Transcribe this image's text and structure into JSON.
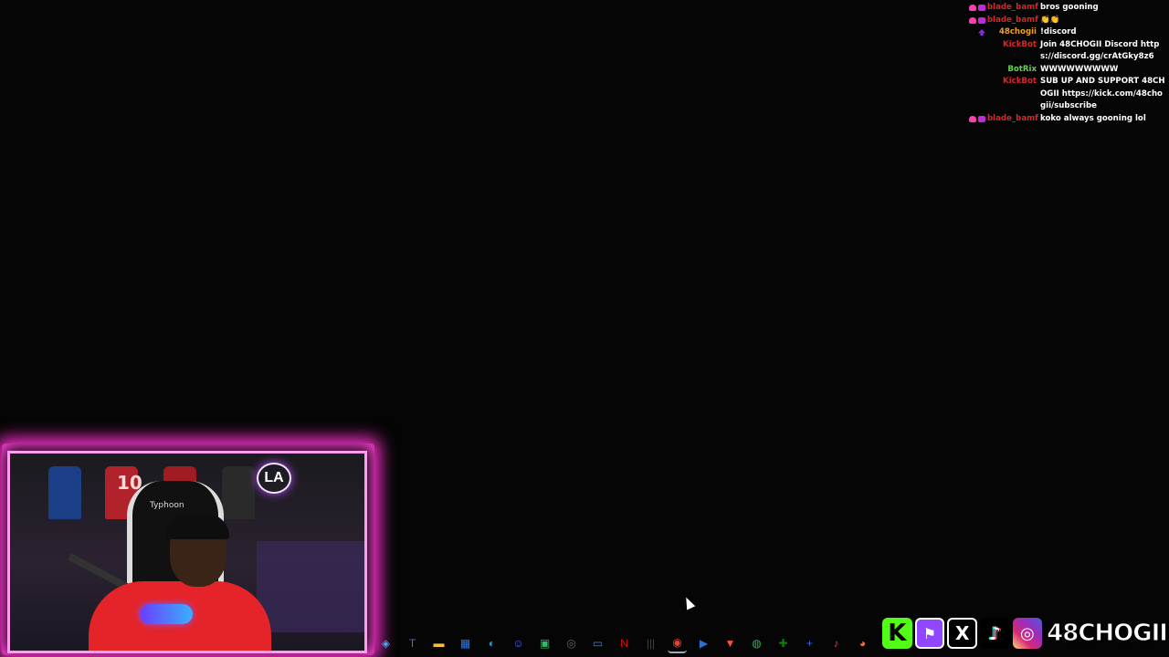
{
  "chat": {
    "messages": [
      {
        "badges": [
          "heart",
          "sub"
        ],
        "user": "blade_bamf",
        "user_color": "red",
        "text": "bros gooning"
      },
      {
        "badges": [
          "heart",
          "sub"
        ],
        "user": "blade_bamf",
        "user_color": "red",
        "text": "👏👏"
      },
      {
        "badges": [
          "up"
        ],
        "user": "48chogii",
        "user_color": "orange",
        "text": "!discord"
      },
      {
        "badges": [],
        "user": "KickBot",
        "user_color": "red",
        "text": "Join 48CHOGII Discord https://discord.gg/crAtGky8z6"
      },
      {
        "badges": [],
        "user": "BotRix",
        "user_color": "green",
        "text": "WWWWWWWWW"
      },
      {
        "badges": [],
        "user": "KickBot",
        "user_color": "red",
        "text": "SUB UP AND SUPPORT 48CHOGII https://kick.com/48chogii/subscribe"
      },
      {
        "badges": [
          "heart",
          "sub"
        ],
        "user": "blade_bamf",
        "user_color": "red",
        "text": "koko always gooning lol"
      }
    ]
  },
  "webcam": {
    "chair_label": "Typhoon",
    "jersey_number": "10",
    "logo_glyph": "LA"
  },
  "taskbar": {
    "icons": [
      {
        "name": "copilot-icon",
        "glyph": "◈",
        "color": "#4aa3ff"
      },
      {
        "name": "teams-icon",
        "glyph": "T",
        "color": "#6264a7"
      },
      {
        "name": "file-explorer-icon",
        "glyph": "▬",
        "color": "#f3c13a"
      },
      {
        "name": "microsoft-store-icon",
        "glyph": "▦",
        "color": "#2d7be5"
      },
      {
        "name": "edge-icon",
        "glyph": "◐",
        "color": "#1fa3d8"
      },
      {
        "name": "discord-icon",
        "glyph": "☺",
        "color": "#5865f2"
      },
      {
        "name": "android-app-icon",
        "glyph": "▣",
        "color": "#39b36b"
      },
      {
        "name": "obs-icon",
        "glyph": "◎",
        "color": "#666"
      },
      {
        "name": "window-app-icon",
        "glyph": "▭",
        "color": "#4e7bbf"
      },
      {
        "name": "netflix-icon",
        "glyph": "N",
        "color": "#e50914"
      },
      {
        "name": "audio-app-icon",
        "glyph": "|||",
        "color": "#444"
      },
      {
        "name": "chrome-icon",
        "glyph": "◉",
        "color": "#e94235",
        "active": true
      },
      {
        "name": "video-player-icon",
        "glyph": "▶",
        "color": "#2c6fd6"
      },
      {
        "name": "brave-icon",
        "glyph": "▼",
        "color": "#fb542b"
      },
      {
        "name": "spotify-icon",
        "glyph": "◍",
        "color": "#1db954"
      },
      {
        "name": "xbox-icon",
        "glyph": "✚",
        "color": "#107c10"
      },
      {
        "name": "plus-app-icon",
        "glyph": "+",
        "color": "#2b6cf0"
      },
      {
        "name": "tiktok-app-icon",
        "glyph": "♪",
        "color": "#fe2c55"
      },
      {
        "name": "firefox-icon",
        "glyph": "◕",
        "color": "#ff7139"
      }
    ]
  },
  "socials": {
    "kick_glyph": "K",
    "twitch_glyph": "⚑",
    "x_glyph": "X",
    "tiktok_glyph": "♪",
    "instagram_glyph": "◎",
    "channel_name": "48CHOGII"
  }
}
